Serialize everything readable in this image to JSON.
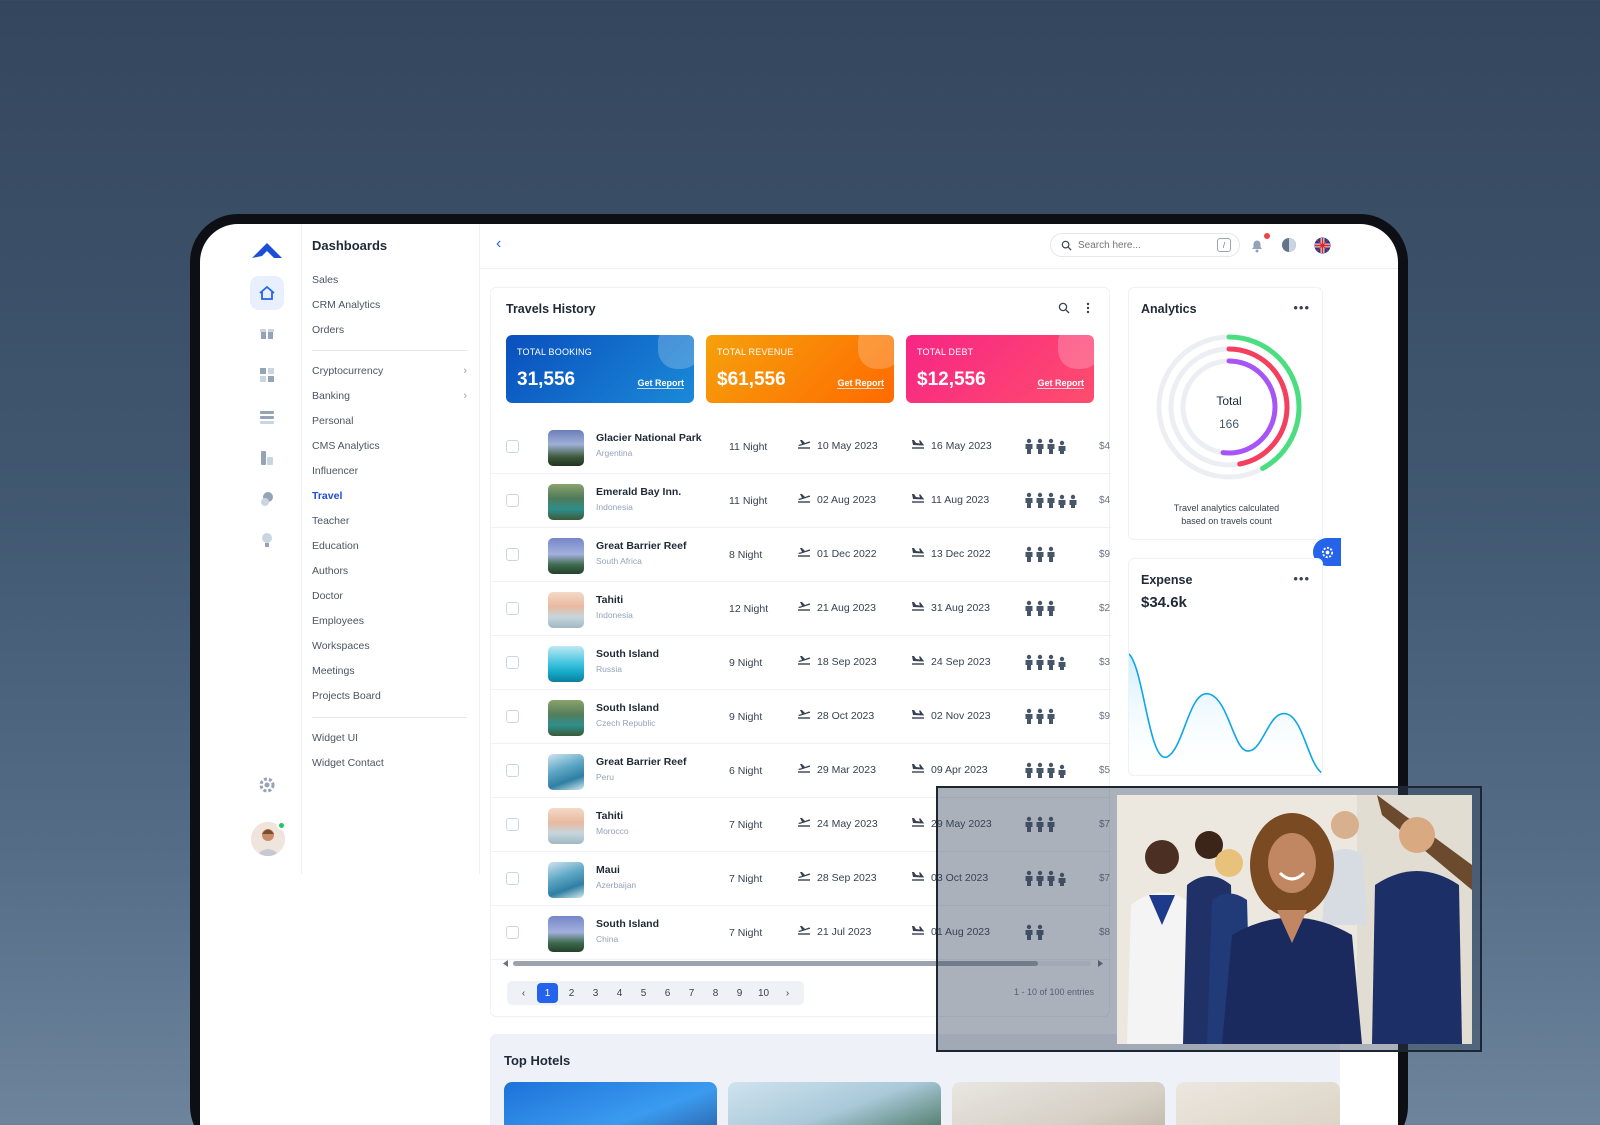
{
  "sidebar": {
    "heading": "Dashboards",
    "items": [
      {
        "label": "Sales"
      },
      {
        "label": "CRM Analytics"
      },
      {
        "label": "Orders"
      },
      {
        "label": "Cryptocurrency",
        "chevron": "›"
      },
      {
        "label": "Banking",
        "chevron": "›"
      },
      {
        "label": "Personal"
      },
      {
        "label": "CMS Analytics"
      },
      {
        "label": "Influencer"
      },
      {
        "label": "Travel",
        "active": true
      },
      {
        "label": "Teacher"
      },
      {
        "label": "Education"
      },
      {
        "label": "Authors"
      },
      {
        "label": "Doctor"
      },
      {
        "label": "Employees"
      },
      {
        "label": "Workspaces"
      },
      {
        "label": "Meetings"
      },
      {
        "label": "Projects Board"
      },
      {
        "label": "Widget UI"
      },
      {
        "label": "Widget Contact"
      }
    ],
    "rail_icons": [
      "home-icon",
      "gift-icon",
      "grid-icon",
      "layers-icon",
      "tools-icon",
      "circles-icon",
      "lightbulb-icon"
    ]
  },
  "topbar": {
    "back": "‹",
    "search_placeholder": "Search here...",
    "search_shortcut": "/"
  },
  "travels": {
    "title": "Travels History",
    "stats": [
      {
        "label": "TOTAL BOOKING",
        "value": "31,556",
        "link": "Get Report",
        "color_from": "#0a4fbd",
        "color_to": "#1a8ad8"
      },
      {
        "label": "TOTAL REVENUE",
        "value": "$61,556",
        "link": "Get Report",
        "color_from": "#f5a10c",
        "color_to": "#ff6a00"
      },
      {
        "label": "TOTAL DEBT",
        "value": "$12,556",
        "link": "Get Report",
        "color_from": "#f72585",
        "color_to": "#ff4d6d"
      }
    ],
    "rows": [
      {
        "place": "Glacier National Park",
        "country": "Argentina",
        "nights": "11 Night",
        "departure": "10 May 2023",
        "arrival": "16 May 2023",
        "people": 4,
        "price": "$4"
      },
      {
        "place": "Emerald Bay Inn.",
        "country": "Indonesia",
        "nights": "11 Night",
        "departure": "02 Aug 2023",
        "arrival": "11 Aug 2023",
        "people": 5,
        "price": "$4"
      },
      {
        "place": "Great Barrier Reef",
        "country": "South Africa",
        "nights": "8 Night",
        "departure": "01 Dec 2022",
        "arrival": "13 Dec 2022",
        "people": 3,
        "price": "$9"
      },
      {
        "place": "Tahiti",
        "country": "Indonesia",
        "nights": "12 Night",
        "departure": "21 Aug 2023",
        "arrival": "31 Aug 2023",
        "people": 3,
        "price": "$2"
      },
      {
        "place": "South Island",
        "country": "Russia",
        "nights": "9 Night",
        "departure": "18 Sep 2023",
        "arrival": "24 Sep 2023",
        "people": 4,
        "price": "$3"
      },
      {
        "place": "South Island",
        "country": "Czech Republic",
        "nights": "9 Night",
        "departure": "28 Oct 2023",
        "arrival": "02 Nov 2023",
        "people": 3,
        "price": "$9"
      },
      {
        "place": "Great Barrier Reef",
        "country": "Peru",
        "nights": "6 Night",
        "departure": "29 Mar 2023",
        "arrival": "09 Apr 2023",
        "people": 4,
        "price": "$5"
      },
      {
        "place": "Tahiti",
        "country": "Morocco",
        "nights": "7 Night",
        "departure": "24 May 2023",
        "arrival": "29 May 2023",
        "people": 3,
        "price": "$7"
      },
      {
        "place": "Maui",
        "country": "Azerbaijan",
        "nights": "7 Night",
        "departure": "28 Sep 2023",
        "arrival": "03 Oct 2023",
        "people": 4,
        "price": "$7"
      },
      {
        "place": "South Island",
        "country": "China",
        "nights": "7 Night",
        "departure": "21 Jul 2023",
        "arrival": "01 Aug 2023",
        "people": 2,
        "price": "$8"
      }
    ],
    "pages": [
      "1",
      "2",
      "3",
      "4",
      "5",
      "6",
      "7",
      "8",
      "9",
      "10"
    ],
    "pager_prev": "‹",
    "pager_next": "›",
    "entries": "1 - 10 of 100 entries"
  },
  "analytics": {
    "title": "Analytics",
    "menu": "•••",
    "total_label": "Total",
    "total_value": "166",
    "note": "Travel analytics calculated based on travels count",
    "rings": [
      {
        "color": "#4ade80",
        "fraction": 0.42
      },
      {
        "color": "#f43f5e",
        "fraction": 0.47
      },
      {
        "color": "#a855f7",
        "fraction": 0.52
      }
    ]
  },
  "expense": {
    "title": "Expense",
    "value": "$34.6k",
    "menu": "•••",
    "line_color": "#0ea5e9"
  },
  "hotels": {
    "title": "Top Hotels"
  }
}
